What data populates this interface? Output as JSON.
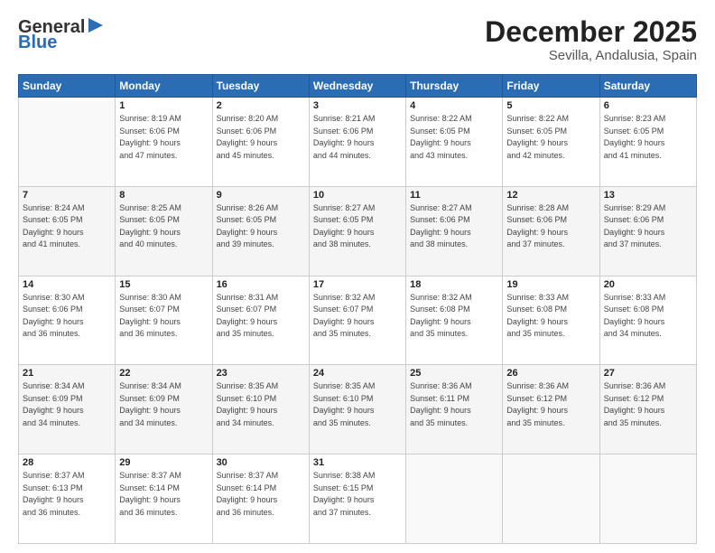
{
  "header": {
    "logo_line1": "General",
    "logo_line2": "Blue",
    "title": "December 2025",
    "subtitle": "Sevilla, Andalusia, Spain"
  },
  "weekdays": [
    "Sunday",
    "Monday",
    "Tuesday",
    "Wednesday",
    "Thursday",
    "Friday",
    "Saturday"
  ],
  "weeks": [
    [
      {
        "day": "",
        "info": []
      },
      {
        "day": "1",
        "info": [
          "Sunrise: 8:19 AM",
          "Sunset: 6:06 PM",
          "Daylight: 9 hours",
          "and 47 minutes."
        ]
      },
      {
        "day": "2",
        "info": [
          "Sunrise: 8:20 AM",
          "Sunset: 6:06 PM",
          "Daylight: 9 hours",
          "and 45 minutes."
        ]
      },
      {
        "day": "3",
        "info": [
          "Sunrise: 8:21 AM",
          "Sunset: 6:06 PM",
          "Daylight: 9 hours",
          "and 44 minutes."
        ]
      },
      {
        "day": "4",
        "info": [
          "Sunrise: 8:22 AM",
          "Sunset: 6:05 PM",
          "Daylight: 9 hours",
          "and 43 minutes."
        ]
      },
      {
        "day": "5",
        "info": [
          "Sunrise: 8:22 AM",
          "Sunset: 6:05 PM",
          "Daylight: 9 hours",
          "and 42 minutes."
        ]
      },
      {
        "day": "6",
        "info": [
          "Sunrise: 8:23 AM",
          "Sunset: 6:05 PM",
          "Daylight: 9 hours",
          "and 41 minutes."
        ]
      }
    ],
    [
      {
        "day": "7",
        "info": [
          "Sunrise: 8:24 AM",
          "Sunset: 6:05 PM",
          "Daylight: 9 hours",
          "and 41 minutes."
        ]
      },
      {
        "day": "8",
        "info": [
          "Sunrise: 8:25 AM",
          "Sunset: 6:05 PM",
          "Daylight: 9 hours",
          "and 40 minutes."
        ]
      },
      {
        "day": "9",
        "info": [
          "Sunrise: 8:26 AM",
          "Sunset: 6:05 PM",
          "Daylight: 9 hours",
          "and 39 minutes."
        ]
      },
      {
        "day": "10",
        "info": [
          "Sunrise: 8:27 AM",
          "Sunset: 6:05 PM",
          "Daylight: 9 hours",
          "and 38 minutes."
        ]
      },
      {
        "day": "11",
        "info": [
          "Sunrise: 8:27 AM",
          "Sunset: 6:06 PM",
          "Daylight: 9 hours",
          "and 38 minutes."
        ]
      },
      {
        "day": "12",
        "info": [
          "Sunrise: 8:28 AM",
          "Sunset: 6:06 PM",
          "Daylight: 9 hours",
          "and 37 minutes."
        ]
      },
      {
        "day": "13",
        "info": [
          "Sunrise: 8:29 AM",
          "Sunset: 6:06 PM",
          "Daylight: 9 hours",
          "and 37 minutes."
        ]
      }
    ],
    [
      {
        "day": "14",
        "info": [
          "Sunrise: 8:30 AM",
          "Sunset: 6:06 PM",
          "Daylight: 9 hours",
          "and 36 minutes."
        ]
      },
      {
        "day": "15",
        "info": [
          "Sunrise: 8:30 AM",
          "Sunset: 6:07 PM",
          "Daylight: 9 hours",
          "and 36 minutes."
        ]
      },
      {
        "day": "16",
        "info": [
          "Sunrise: 8:31 AM",
          "Sunset: 6:07 PM",
          "Daylight: 9 hours",
          "and 35 minutes."
        ]
      },
      {
        "day": "17",
        "info": [
          "Sunrise: 8:32 AM",
          "Sunset: 6:07 PM",
          "Daylight: 9 hours",
          "and 35 minutes."
        ]
      },
      {
        "day": "18",
        "info": [
          "Sunrise: 8:32 AM",
          "Sunset: 6:08 PM",
          "Daylight: 9 hours",
          "and 35 minutes."
        ]
      },
      {
        "day": "19",
        "info": [
          "Sunrise: 8:33 AM",
          "Sunset: 6:08 PM",
          "Daylight: 9 hours",
          "and 35 minutes."
        ]
      },
      {
        "day": "20",
        "info": [
          "Sunrise: 8:33 AM",
          "Sunset: 6:08 PM",
          "Daylight: 9 hours",
          "and 34 minutes."
        ]
      }
    ],
    [
      {
        "day": "21",
        "info": [
          "Sunrise: 8:34 AM",
          "Sunset: 6:09 PM",
          "Daylight: 9 hours",
          "and 34 minutes."
        ]
      },
      {
        "day": "22",
        "info": [
          "Sunrise: 8:34 AM",
          "Sunset: 6:09 PM",
          "Daylight: 9 hours",
          "and 34 minutes."
        ]
      },
      {
        "day": "23",
        "info": [
          "Sunrise: 8:35 AM",
          "Sunset: 6:10 PM",
          "Daylight: 9 hours",
          "and 34 minutes."
        ]
      },
      {
        "day": "24",
        "info": [
          "Sunrise: 8:35 AM",
          "Sunset: 6:10 PM",
          "Daylight: 9 hours",
          "and 35 minutes."
        ]
      },
      {
        "day": "25",
        "info": [
          "Sunrise: 8:36 AM",
          "Sunset: 6:11 PM",
          "Daylight: 9 hours",
          "and 35 minutes."
        ]
      },
      {
        "day": "26",
        "info": [
          "Sunrise: 8:36 AM",
          "Sunset: 6:12 PM",
          "Daylight: 9 hours",
          "and 35 minutes."
        ]
      },
      {
        "day": "27",
        "info": [
          "Sunrise: 8:36 AM",
          "Sunset: 6:12 PM",
          "Daylight: 9 hours",
          "and 35 minutes."
        ]
      }
    ],
    [
      {
        "day": "28",
        "info": [
          "Sunrise: 8:37 AM",
          "Sunset: 6:13 PM",
          "Daylight: 9 hours",
          "and 36 minutes."
        ]
      },
      {
        "day": "29",
        "info": [
          "Sunrise: 8:37 AM",
          "Sunset: 6:14 PM",
          "Daylight: 9 hours",
          "and 36 minutes."
        ]
      },
      {
        "day": "30",
        "info": [
          "Sunrise: 8:37 AM",
          "Sunset: 6:14 PM",
          "Daylight: 9 hours",
          "and 36 minutes."
        ]
      },
      {
        "day": "31",
        "info": [
          "Sunrise: 8:38 AM",
          "Sunset: 6:15 PM",
          "Daylight: 9 hours",
          "and 37 minutes."
        ]
      },
      {
        "day": "",
        "info": []
      },
      {
        "day": "",
        "info": []
      },
      {
        "day": "",
        "info": []
      }
    ]
  ]
}
